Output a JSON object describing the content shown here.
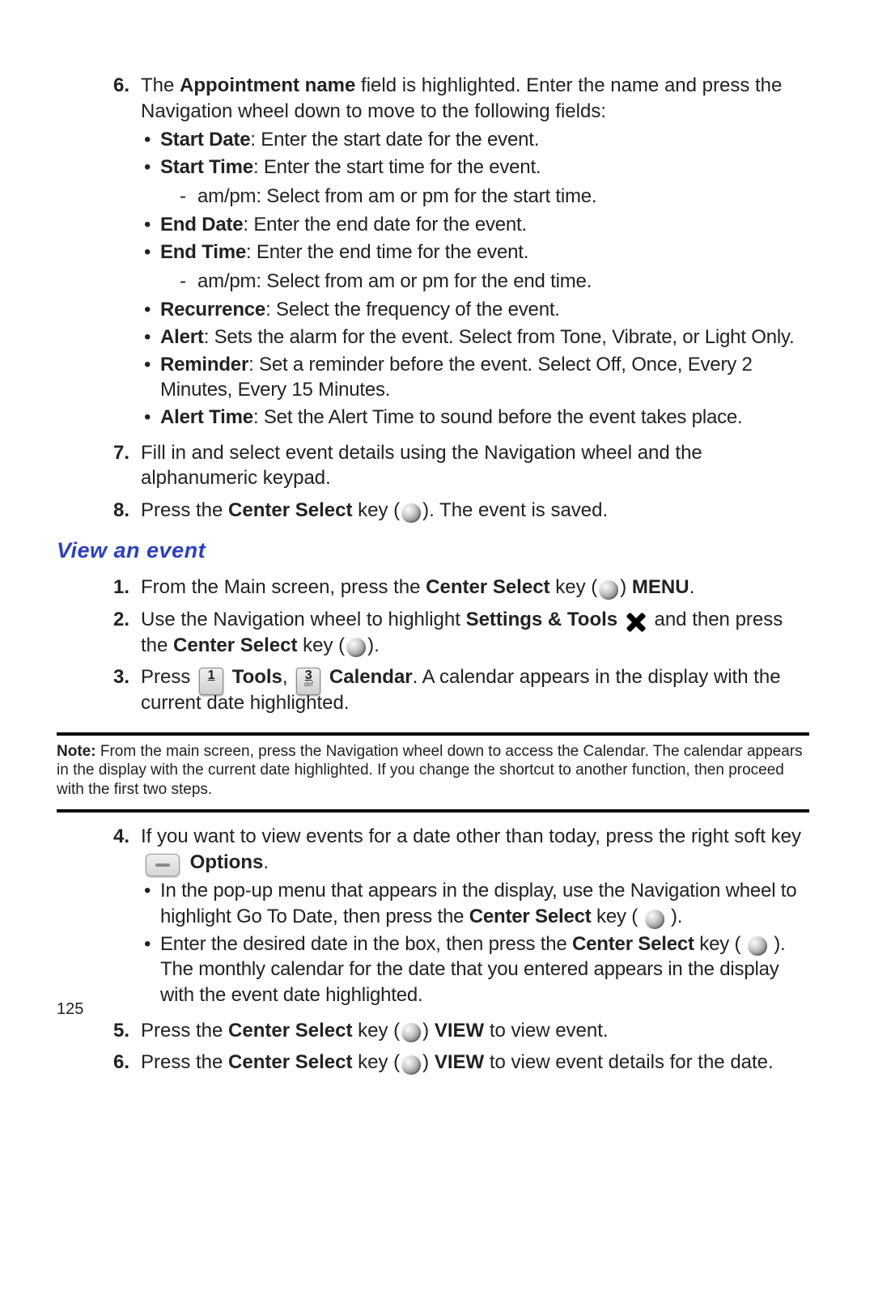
{
  "pageNumber": "125",
  "list1": {
    "num6": "6.",
    "item6_pre": "The ",
    "item6_bold": "Appointment name",
    "item6_post": " field is highlighted. Enter the name and press the Navigation wheel down to move to the following fields:",
    "bul6": {
      "a_b": "Start Date",
      "a_t": ": Enter the start date for the event.",
      "b_b": "Start Time",
      "b_t": ": Enter the start time for the event.",
      "b_sub": "am/pm: Select from am or pm for the start time.",
      "c_b": "End Date",
      "c_t": ": Enter the end date for the event.",
      "d_b": "End Time",
      "d_t": ": Enter the end time for the event.",
      "d_sub": "am/pm: Select from am or pm for the end time.",
      "e_b": "Recurrence",
      "e_t": ": Select the frequency of the event.",
      "f_b": "Alert",
      "f_t": ": Sets the alarm for the event. Select from Tone, Vibrate, or Light Only.",
      "g_b": "Reminder",
      "g_t": ": Set a reminder before the event. Select Off, Once, Every 2 Minutes, Every 15 Minutes.",
      "h_b": "Alert Time",
      "h_t": ": Set the Alert Time to sound before the event takes place."
    },
    "num7": "7.",
    "item7": "Fill in and select event details using the Navigation wheel and the alphanumeric keypad.",
    "num8": "8.",
    "item8_pre": "Press the ",
    "item8_b": "Center Select",
    "item8_mid": " key (",
    "item8_post": "). The event is saved."
  },
  "heading": "View an event",
  "list2": {
    "num1": "1.",
    "s1_pre": "From the Main screen, press the ",
    "s1_b1": "Center Select",
    "s1_mid": " key (",
    "s1_close": ") ",
    "s1_b2": "MENU",
    "s1_end": ".",
    "num2": "2.",
    "s2_pre": "Use the Navigation wheel to highlight ",
    "s2_b1": "Settings & Tools",
    "s2_mid": " and then press the ",
    "s2_b2": "Center Select",
    "s2_mid2": " key (",
    "s2_end": ").",
    "num3": "3.",
    "s3_pre": "Press ",
    "s3_key1_main": "1",
    "s3_key1_sub": "",
    "s3_b1": "Tools",
    "s3_sep": ", ",
    "s3_key2_main": "3",
    "s3_key2_sub": "def",
    "s3_b2": "Calendar",
    "s3_post": ". A calendar appears in the display with the current date highlighted."
  },
  "note": {
    "label": "Note:",
    "text": " From the main screen, press the Navigation wheel down to access the Calendar. The calendar appears in the display with the current date highlighted. If you change the shortcut to another function, then proceed with the first two steps."
  },
  "list3": {
    "num4": "4.",
    "s4_pre": "If you want to view events for a date other than today, press the right soft key ",
    "s4_b": "Options",
    "s4_end": ".",
    "s4_bul": {
      "a_pre": "In the pop-up menu that appears in the display, use the Navigation wheel to highlight Go To Date, then press the ",
      "a_b": "Center Select",
      "a_mid": " key ( ",
      "a_end": " ).",
      "b_pre": "Enter the desired date in the box, then press the ",
      "b_b": "Center Select",
      "b_mid": " key ( ",
      "b_mid2": " ). The monthly calendar for the date that you entered appears in the display with the event date highlighted."
    },
    "num5": "5.",
    "s5_pre": "Press the ",
    "s5_b1": "Center Select",
    "s5_mid": " key (",
    "s5_close": ") ",
    "s5_b2": "VIEW",
    "s5_end": " to view event.",
    "num6": "6.",
    "s6_pre": "Press the ",
    "s6_b1": "Center Select",
    "s6_mid": " key (",
    "s6_close": ") ",
    "s6_b2": "VIEW",
    "s6_end": " to view event details for the date."
  }
}
